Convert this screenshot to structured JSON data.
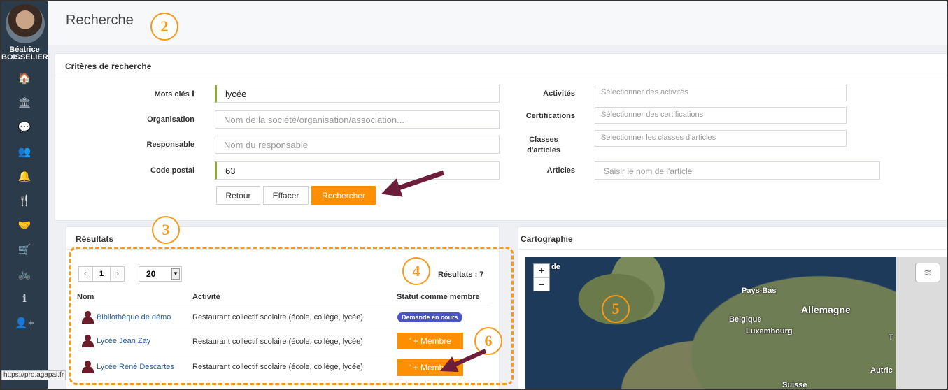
{
  "user": {
    "first_name": "Béatrice",
    "last_name": "BOISSELIER"
  },
  "sidebar": {
    "items": [
      {
        "icon": "home-icon",
        "glyph": "🏠"
      },
      {
        "icon": "institution-icon",
        "glyph": "🏛"
      },
      {
        "icon": "comments-icon",
        "glyph": "💬"
      },
      {
        "icon": "users-icon",
        "glyph": "👥"
      },
      {
        "icon": "bell-icon",
        "glyph": "🔔"
      },
      {
        "icon": "cutlery-icon",
        "glyph": "🍴"
      },
      {
        "icon": "handshake-icon",
        "glyph": "🤝"
      },
      {
        "icon": "cart-icon",
        "glyph": "🛒"
      },
      {
        "icon": "bicycle-icon",
        "glyph": "🚲"
      },
      {
        "icon": "info-icon",
        "glyph": "ℹ"
      },
      {
        "icon": "add-user-icon",
        "glyph": "👤+"
      }
    ]
  },
  "status_url": "https://pro.agapai.fr",
  "header": {
    "title": "Recherche"
  },
  "criteria": {
    "title": "Critères de recherche",
    "keywords_label": "Mots clés",
    "keywords_info": "ℹ",
    "keywords_value": "lycée",
    "organisation_label": "Organisation",
    "organisation_placeholder": "Nom de la société/organisation/association...",
    "responsable_label": "Responsable",
    "responsable_placeholder": "Nom du responsable",
    "postal_label": "Code postal",
    "postal_value": "63",
    "activities_label": "Activités",
    "activities_placeholder": "Sélectionner des activités",
    "certifications_label": "Certifications",
    "certifications_placeholder": "Sélectionner des certifications",
    "classes_label_1": "Classes",
    "classes_label_2": "d'articles",
    "classes_placeholder": "Selectionner les classes d'articles",
    "articles_label": "Articles",
    "articles_placeholder": "Saisir le nom de l'article",
    "back_label": "Retour",
    "clear_label": "Effacer",
    "search_label": "Rechercher"
  },
  "results": {
    "title": "Résultats",
    "pager": {
      "prev": "‹",
      "page": "1",
      "next": "›",
      "page_size": "20"
    },
    "count": "Résultats : 7",
    "columns": [
      "Nom",
      "Activité",
      "Statut comme membre"
    ],
    "rows": [
      {
        "name": "Bibliothèque de démo",
        "activity": "Restaurant collectif scolaire (école, collège, lycée)",
        "status": "Demande en cours"
      },
      {
        "name": "Lycée Jean Zay",
        "activity": "Restaurant collectif scolaire (école, collège, lycée)",
        "status": "' + Membre"
      },
      {
        "name": "Lycée René Descartes",
        "activity": "Restaurant collectif scolaire (école, collège, lycée)",
        "status": "' + Membre"
      }
    ]
  },
  "map": {
    "title": "Cartographie",
    "zoom_in": "+",
    "zoom_out": "−",
    "labels": {
      "de": "de",
      "pays_bas": "Pays-Bas",
      "allemagne": "Allemagne",
      "belgique": "Belgique",
      "luxembourg": "Luxembourg",
      "autriche": "Autric",
      "suisse": "Suisse",
      "t": "T"
    }
  },
  "annotations": [
    "2",
    "3",
    "4",
    "5",
    "6"
  ],
  "colors": {
    "sidebar": "#2c3b4a",
    "accent": "#fd8f00",
    "annotation": "#f59a1c",
    "arrow": "#6b1d3a",
    "link": "#2a5fa8",
    "badge": "#4a54c7"
  }
}
